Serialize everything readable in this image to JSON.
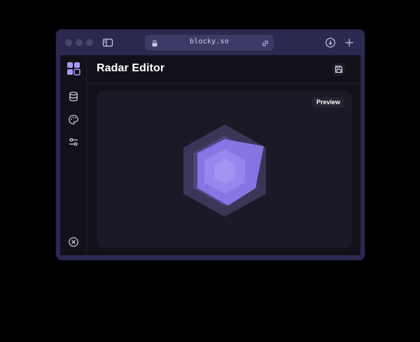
{
  "browser": {
    "url": "blocky.so",
    "icons": {
      "sidebar_toggle": "sidebar-toggle-icon",
      "lock": "lock-icon",
      "link": "link-icon",
      "download": "download-icon",
      "new_tab": "plus-icon"
    }
  },
  "app": {
    "title": "Radar Editor",
    "rail": {
      "logo": "blocks-logo-icon",
      "items": [
        {
          "icon": "database-icon"
        },
        {
          "icon": "palette-icon"
        },
        {
          "icon": "sliders-icon"
        }
      ],
      "close_icon": "close-circle-icon"
    },
    "header": {
      "save_icon": "save-icon"
    },
    "preview": {
      "badge": "Preview"
    }
  },
  "colors": {
    "window_frame": "#2b2950",
    "app_bg": "#12111a",
    "panel_bg": "#1a1926",
    "accent": "#8f7cf0",
    "logo": "#a898f5"
  }
}
